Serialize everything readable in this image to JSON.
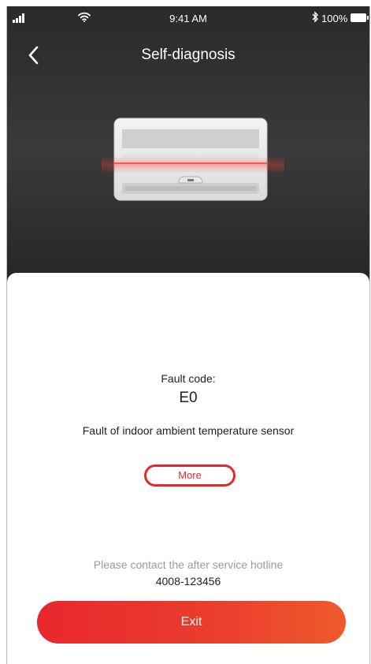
{
  "status_bar": {
    "time": "9:41 AM",
    "battery_text": "100%",
    "signal_icon": "signal-icon",
    "wifi_icon": "wifi-icon",
    "bluetooth_icon": "bluetooth-icon",
    "battery_icon": "battery-icon"
  },
  "navbar": {
    "title": "Self-diagnosis",
    "back_icon": "chevron-left-icon"
  },
  "diagnosis": {
    "fault_label": "Fault code:",
    "fault_code": "E0",
    "fault_description": "Fault of indoor ambient temperature sensor",
    "more_label": "More"
  },
  "contact": {
    "hint": "Please contact the after service hotline",
    "hotline": "4008-123456"
  },
  "actions": {
    "exit_label": "Exit"
  },
  "colors": {
    "accent": "#e5272e",
    "header_bg": "#2a2a2a",
    "hint_text": "#9a9a9a"
  }
}
